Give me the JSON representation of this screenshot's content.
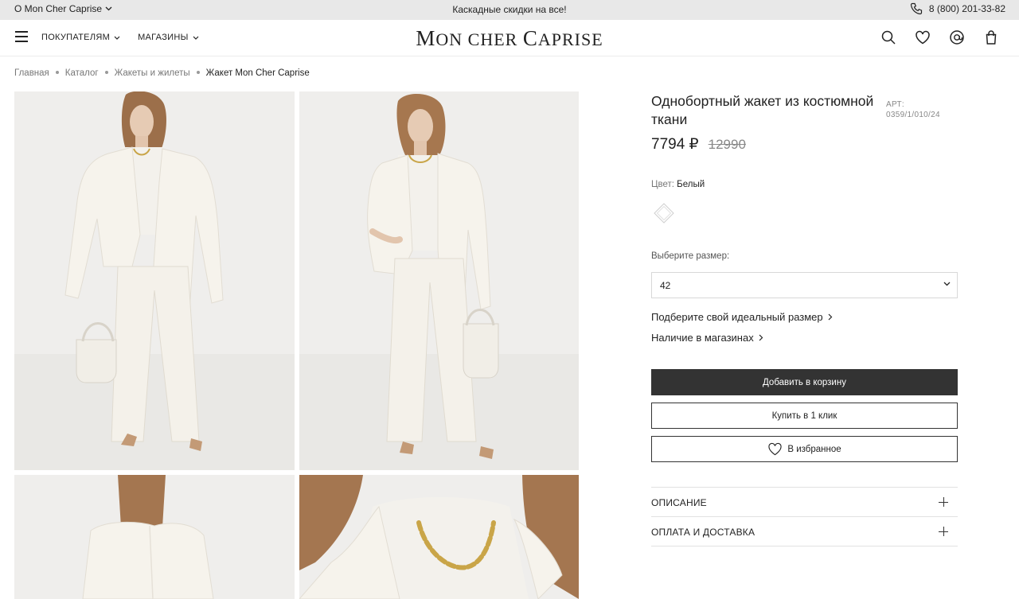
{
  "topbar": {
    "about_label": "О Mon Cher Caprise",
    "promo": "Каскадные скидки на все!",
    "phone": "8 (800) 201-33-82"
  },
  "header": {
    "nav": [
      {
        "label": "ПОКУПАТЕЛЯМ"
      },
      {
        "label": "МАГАЗИНЫ"
      }
    ],
    "logo": {
      "part1": "M",
      "part2": "ON CHER ",
      "part3": "C",
      "part4": "APRISE"
    },
    "icons": [
      "search-icon",
      "heart-icon",
      "account-icon",
      "bag-icon"
    ]
  },
  "breadcrumb": [
    {
      "label": "Главная"
    },
    {
      "label": "Каталог"
    },
    {
      "label": "Жакеты и жилеты"
    },
    {
      "label": "Жакет Mon Cher Caprise"
    }
  ],
  "product": {
    "title": "Однобортный жакет из костюмной ткани",
    "art_label": "АРТ:",
    "art_value": "0359/1/010/24",
    "price_now": "7794 ₽",
    "price_old": "12990",
    "color_label": "Цвет:",
    "color_value": "Белый",
    "size_label": "Выберите размер:",
    "size_value": "42",
    "size_guide": "Подберите свой идеальный размер",
    "availability": "Наличие в магазинах",
    "add_to_cart": "Добавить в корзину",
    "buy_one_click": "Купить в 1 клик",
    "favorite": "В избранное",
    "accordion": [
      {
        "label": "ОПИСАНИЕ"
      },
      {
        "label": "ОПЛАТА И ДОСТАВКА"
      }
    ]
  },
  "colors": {
    "dark_button": "#333333",
    "topbar": "#e8e8e8",
    "photo_bg": "#efeeec"
  }
}
